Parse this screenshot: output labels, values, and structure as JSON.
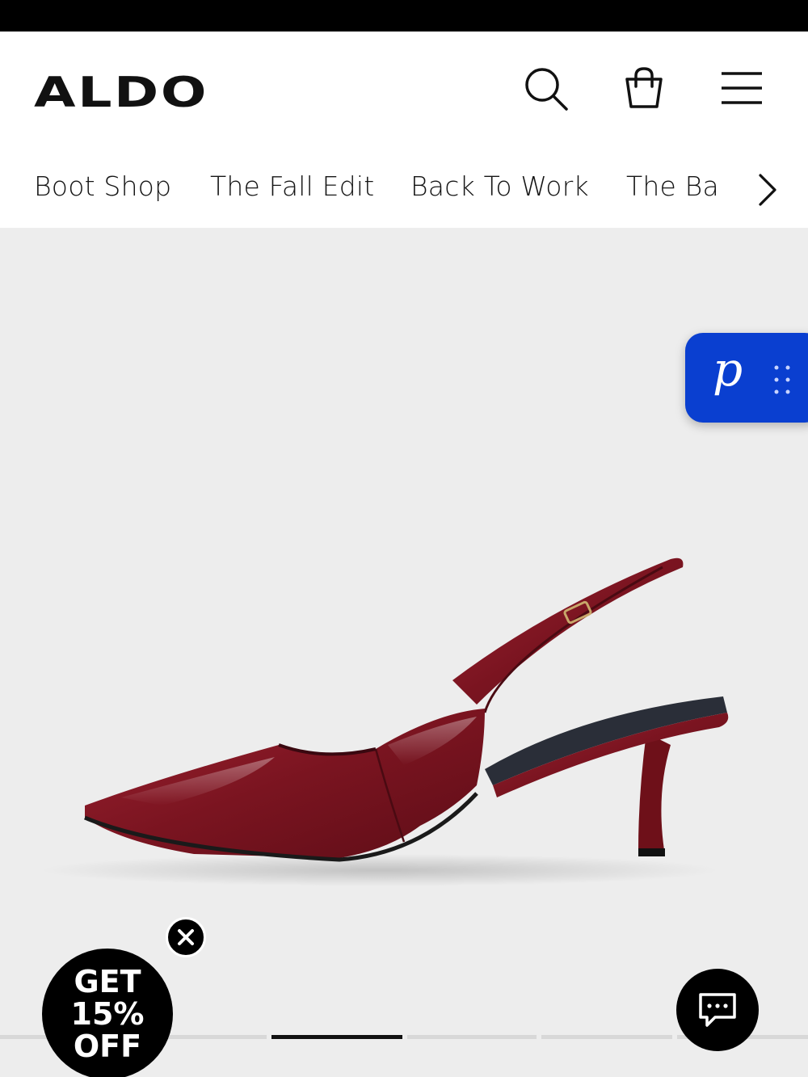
{
  "brand": {
    "logo_text": "ALDO"
  },
  "header": {
    "icons": [
      "search-icon",
      "shopping-bag-icon",
      "hamburger-menu-icon"
    ]
  },
  "nav": {
    "items": [
      {
        "label": "Boot Shop"
      },
      {
        "label": "The Fall Edit"
      },
      {
        "label": "Back To Work"
      },
      {
        "label": "The Bag"
      }
    ],
    "next_icon": "chevron-right-icon"
  },
  "hero": {
    "image": "red patent slingback pointed-toe kitten heel pump",
    "colors": {
      "background": "#ededed",
      "shoe": "#7a1420"
    }
  },
  "widget": {
    "letter": "p",
    "color": "#0a3fd0"
  },
  "promo": {
    "line1": "GET",
    "line2": "15%",
    "line3": "OFF"
  },
  "carousel": {
    "slides": 6,
    "active": 2
  },
  "chat": {
    "icon": "chat-bubble-icon"
  }
}
